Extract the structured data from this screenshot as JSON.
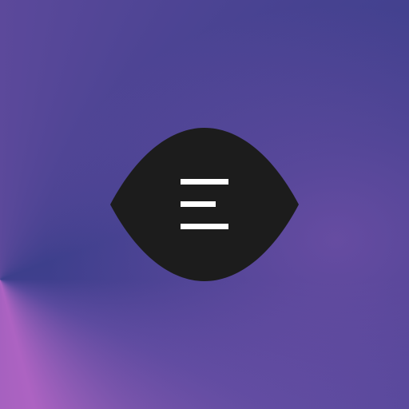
{
  "app": {
    "icon": "menu-icon",
    "colors": {
      "background_start": "#3d3f8c",
      "background_end": "#ad63c2",
      "badge": "#1c1c1c",
      "glyph": "#ffffff"
    }
  }
}
